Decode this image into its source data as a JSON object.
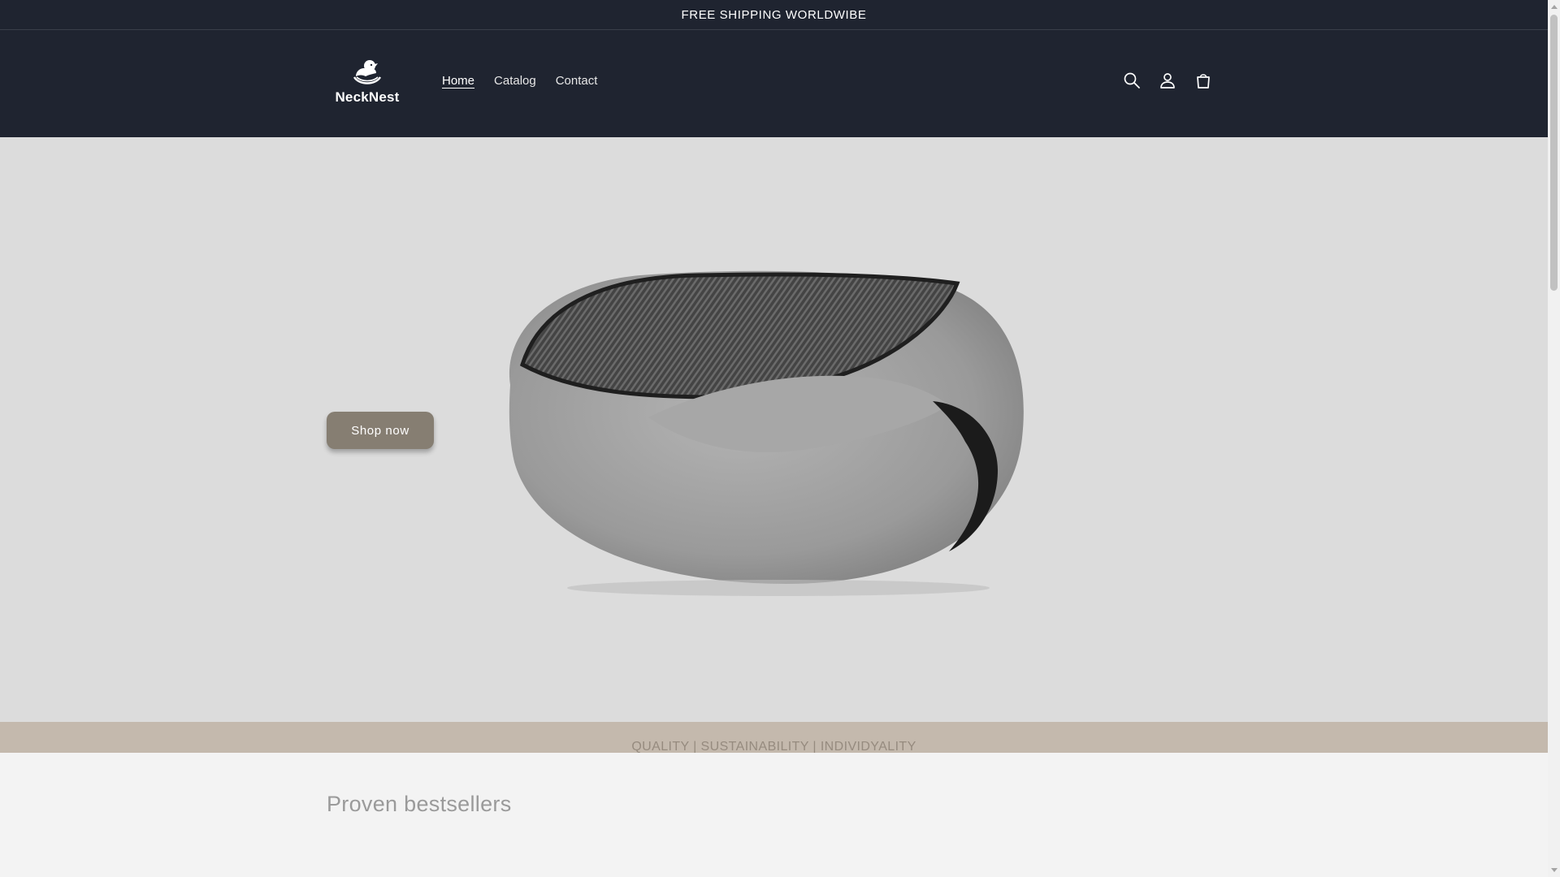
{
  "announcement": {
    "text": "FREE SHIPPING WORLDWIBE"
  },
  "header": {
    "logo_text": "NeckNest",
    "nav": [
      {
        "label": "Home",
        "active": true
      },
      {
        "label": "Catalog",
        "active": false
      },
      {
        "label": "Contact",
        "active": false
      }
    ],
    "icons": [
      "search-icon",
      "account-icon",
      "cart-icon"
    ]
  },
  "hero": {
    "image": "travel-neck-pillow-image",
    "button_label": "Shop now"
  },
  "tagline": {
    "text": "QUALITY | SUSTAINABILITY | INDIVIDYALITY"
  },
  "bestsellers": {
    "title": "Proven bestsellers"
  },
  "colors": {
    "header_bg": "#1f2430",
    "hero_bg": "#dcdcdc",
    "button_bg": "#867e72",
    "tagline_bg": "#c4b9ad"
  }
}
